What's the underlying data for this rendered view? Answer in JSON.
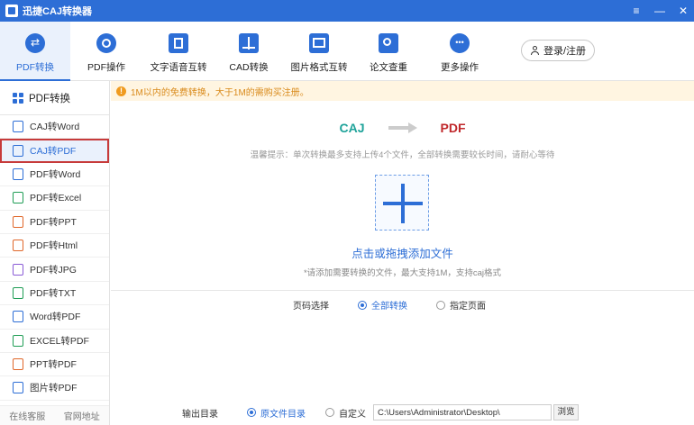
{
  "app": {
    "title": "迅捷CAJ转换器"
  },
  "window_controls": {
    "menu": "≡",
    "minimize": "—",
    "close": "✕"
  },
  "toolbar": {
    "items": [
      {
        "label": "PDF转换",
        "icon": "swap-icon"
      },
      {
        "label": "PDF操作",
        "icon": "gear-icon"
      },
      {
        "label": "文字语音互转",
        "icon": "speech-icon"
      },
      {
        "label": "CAD转换",
        "icon": "cad-icon"
      },
      {
        "label": "图片格式互转",
        "icon": "image-icon"
      },
      {
        "label": "论文查重",
        "icon": "search-doc-icon"
      },
      {
        "label": "更多操作",
        "icon": "more-icon"
      }
    ],
    "login_label": "登录/注册"
  },
  "sidebar": {
    "heading": "PDF转换",
    "items": [
      {
        "label": "CAJ转Word",
        "color": "#2d6ed6"
      },
      {
        "label": "CAJ转PDF",
        "color": "#2d6ed6"
      },
      {
        "label": "PDF转Word",
        "color": "#2d6ed6"
      },
      {
        "label": "PDF转Excel",
        "color": "#1f9d55"
      },
      {
        "label": "PDF转PPT",
        "color": "#e0672a"
      },
      {
        "label": "PDF转Html",
        "color": "#e0672a"
      },
      {
        "label": "PDF转JPG",
        "color": "#8a5bd6"
      },
      {
        "label": "PDF转TXT",
        "color": "#1f9d55"
      },
      {
        "label": "Word转PDF",
        "color": "#2d6ed6"
      },
      {
        "label": "EXCEL转PDF",
        "color": "#1f9d55"
      },
      {
        "label": "PPT转PDF",
        "color": "#e0672a"
      },
      {
        "label": "图片转PDF",
        "color": "#2d6ed6"
      }
    ],
    "footer": {
      "service": "在线客服",
      "website": "官网地址"
    }
  },
  "notice": "1M以内的免费转换，大于1M的需购买注册。",
  "conversion": {
    "from": "CAJ",
    "to": "PDF"
  },
  "tip": "温馨提示：单次转换最多支持上传4个文件，全部转换需要较长时间，请耐心等待",
  "dropzone": {
    "label": "点击或拖拽添加文件",
    "hint": "*请添加需要转换的文件，最大支持1M，支持caj格式"
  },
  "page_select": {
    "label": "页码选择",
    "options": [
      "全部转换",
      "指定页面"
    ],
    "selected": "全部转换"
  },
  "output": {
    "label": "输出目录",
    "options": [
      "原文件目录",
      "自定义"
    ],
    "selected": "原文件目录",
    "path": "C:\\Users\\Administrator\\Desktop\\",
    "browse_label": "浏览"
  },
  "colors": {
    "accent": "#2d6ed6",
    "caj": "#1fa39a",
    "pdf": "#c0282b",
    "warning": "#d98a1a"
  }
}
